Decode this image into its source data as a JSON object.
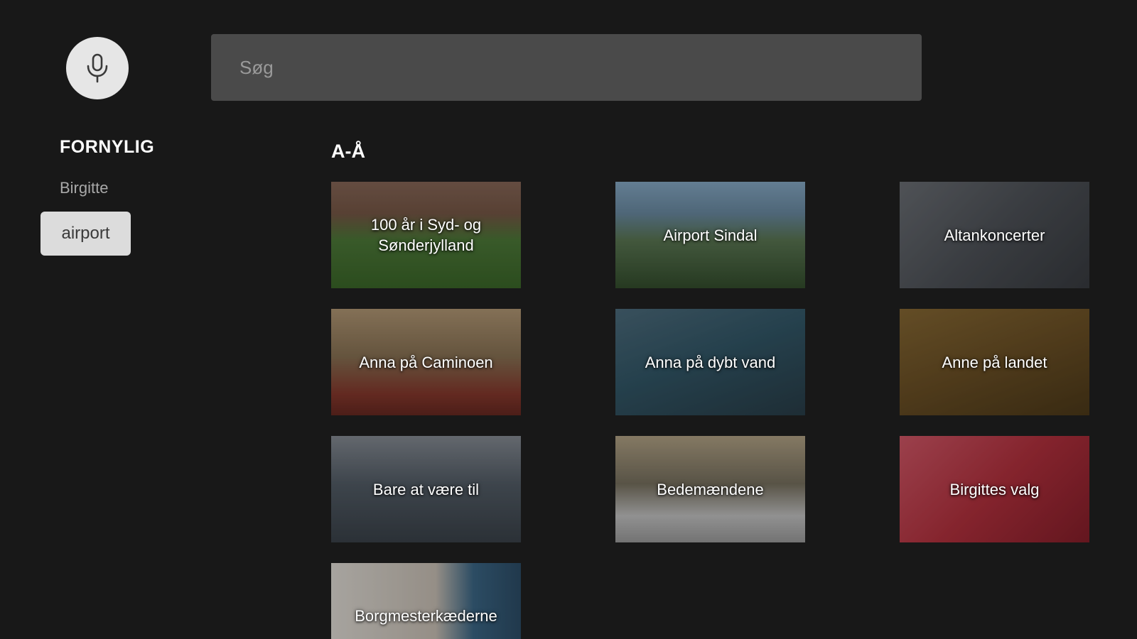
{
  "search": {
    "placeholder": "Søg",
    "value": ""
  },
  "mic": {
    "icon": "microphone-icon"
  },
  "recent": {
    "heading": "FORNYLIG",
    "items": [
      "Birgitte"
    ],
    "selected": "airport"
  },
  "results": {
    "section_title": "A-Å",
    "tiles": [
      {
        "label": "100 år i Syd- og Sønderjylland"
      },
      {
        "label": "Airport Sindal"
      },
      {
        "label": "Altankoncerter"
      },
      {
        "label": "Anna på Caminoen"
      },
      {
        "label": "Anna på dybt vand"
      },
      {
        "label": "Anne på landet"
      },
      {
        "label": "Bare at være til"
      },
      {
        "label": "Bedemændene"
      },
      {
        "label": "Birgittes valg"
      },
      {
        "label": "Borgmesterkæderne"
      }
    ]
  }
}
